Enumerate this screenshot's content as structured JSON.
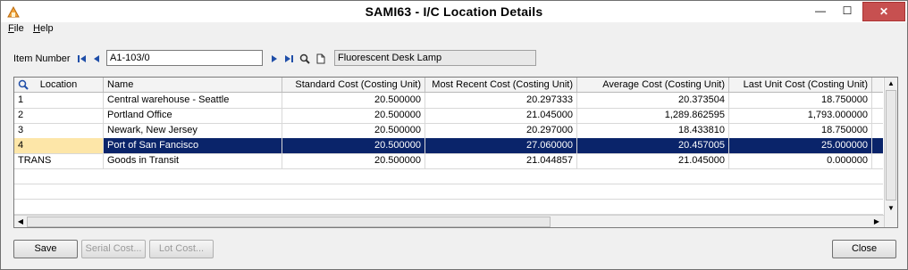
{
  "window": {
    "title": "SAMI63 - I/C Location Details",
    "min_glyph": "—",
    "max_glyph": "☐",
    "close_glyph": "✕"
  },
  "menu": {
    "file": "File",
    "help": "Help"
  },
  "item": {
    "label": "Item Number",
    "value": "A1-103/0",
    "description": "Fluorescent Desk Lamp"
  },
  "grid": {
    "columns": [
      "Location",
      "Name",
      "Standard Cost (Costing Unit)",
      "Most Recent Cost (Costing Unit)",
      "Average Cost (Costing Unit)",
      "Last Unit Cost (Costing Unit)"
    ],
    "rows": [
      [
        "1",
        "Central warehouse - Seattle",
        "20.500000",
        "20.297333",
        "20.373504",
        "18.750000"
      ],
      [
        "2",
        "Portland Office",
        "20.500000",
        "21.045000",
        "1,289.862595",
        "1,793.000000"
      ],
      [
        "3",
        "Newark, New Jersey",
        "20.500000",
        "20.297000",
        "18.433810",
        "18.750000"
      ],
      [
        "4",
        "Port of San Fancisco",
        "20.500000",
        "27.060000",
        "20.457005",
        "25.000000"
      ],
      [
        "TRANS",
        "Goods in Transit",
        "20.500000",
        "21.044857",
        "21.045000",
        "0.000000"
      ]
    ],
    "selected_row": 3
  },
  "buttons": {
    "save": "Save",
    "serial_cost": "Serial Cost...",
    "lot_cost": "Lot Cost...",
    "close": "Close"
  },
  "colors": {
    "selection": "#0a246a",
    "selected_location_cell": "#fde6a8",
    "nav_icon": "#1f4ea8"
  }
}
